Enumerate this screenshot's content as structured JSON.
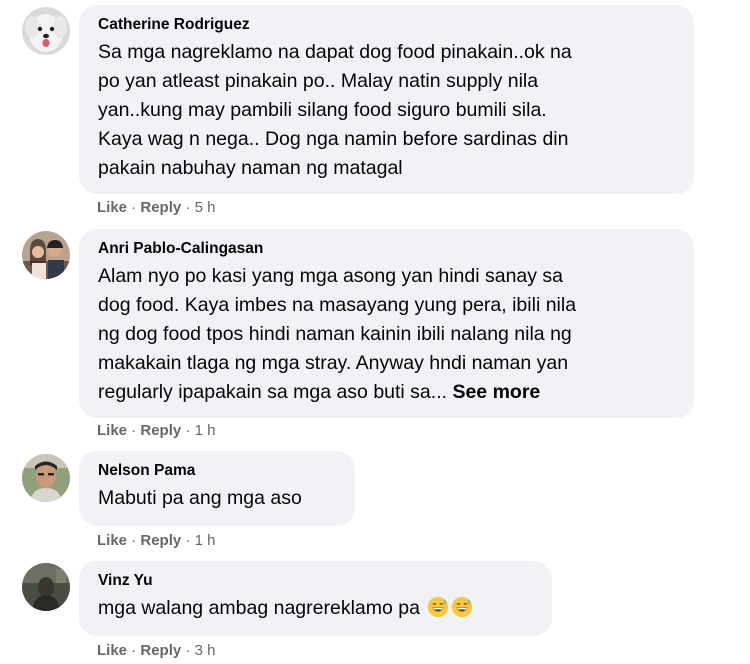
{
  "comments": [
    {
      "author": "Catherine Rodriguez",
      "lines": [
        "Sa mga nagreklamo na dapat dog food pinakain..ok na",
        "po yan atleast pinakain po.. Malay natin supply nila",
        "yan..kung may pambili silang food siguro bumili sila.",
        "Kaya wag n nega.. Dog nga namin before sardinas din",
        "pakain nabuhay naman ng matagal"
      ],
      "like_label": "Like",
      "separator": " · ",
      "reply_label": "Reply",
      "time": "5 h"
    },
    {
      "author": "Anri Pablo-Calingasan",
      "lines": [
        "Alam nyo po kasi yang mga asong yan hindi sanay sa",
        "dog food. Kaya imbes na masayang yung pera, ibili nila",
        "ng dog food tpos hindi naman kainin ibili nalang nila ng",
        "makakain tlaga ng mga stray. Anyway hndi naman yan",
        "regularly ipapakain sa mga aso buti sa..."
      ],
      "see_more": "See more",
      "like_label": "Like",
      "separator": " · ",
      "reply_label": "Reply",
      "time": "1 h"
    },
    {
      "author": "Nelson Pama",
      "lines": [
        "Mabuti pa ang mga aso"
      ],
      "like_label": "Like",
      "separator": " · ",
      "reply_label": "Reply",
      "time": "1 h"
    },
    {
      "author": "Vinz Yu",
      "lines": [
        "mga walang ambag nagrereklamo pa"
      ],
      "emoji_icons": [
        "grinning-sweat-emoji",
        "grinning-sweat-emoji"
      ],
      "like_label": "Like",
      "separator": " · ",
      "reply_label": "Reply",
      "time": "3 h"
    }
  ],
  "colors": {
    "bubble": "#f0f2f5",
    "text": "#050505",
    "meta": "#65676b"
  }
}
